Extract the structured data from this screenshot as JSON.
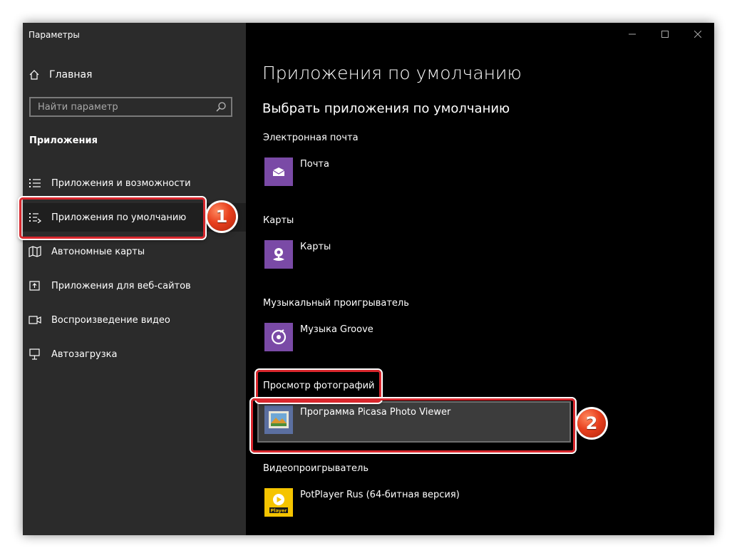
{
  "window": {
    "title": "Параметры"
  },
  "sidebar": {
    "home_label": "Главная",
    "search_placeholder": "Найти параметр",
    "section_title": "Приложения",
    "items": [
      {
        "label": "Приложения и возможности",
        "icon": "list-icon"
      },
      {
        "label": "Приложения по умолчанию",
        "icon": "default-apps-icon",
        "selected": true
      },
      {
        "label": "Автономные карты",
        "icon": "map-icon"
      },
      {
        "label": "Приложения для веб-сайтов",
        "icon": "web-app-icon"
      },
      {
        "label": "Воспроизведение видео",
        "icon": "video-icon"
      },
      {
        "label": "Автозагрузка",
        "icon": "startup-icon"
      }
    ]
  },
  "main": {
    "title": "Приложения по умолчанию",
    "subtitle": "Выбрать приложения по умолчанию",
    "categories": [
      {
        "label": "Электронная почта",
        "app": "Почта",
        "icon": "mail-icon"
      },
      {
        "label": "Карты",
        "app": "Карты",
        "icon": "maps-icon"
      },
      {
        "label": "Музыкальный проигрыватель",
        "app": "Музыка Groove",
        "icon": "groove-icon"
      },
      {
        "label": "Просмотр фотографий",
        "app": "Программа Picasa Photo Viewer",
        "icon": "photo-viewer-icon"
      },
      {
        "label": "Видеопроигрыватель",
        "app": "PotPlayer Rus (64-битная версия)",
        "icon": "potplayer-icon",
        "icon_text": "Player"
      }
    ]
  },
  "annotations": {
    "badge_1": "1",
    "badge_2": "2"
  },
  "colors": {
    "accent": "#7a4aa6",
    "annotation": "#d9272d",
    "sidebar_bg": "#2b2b2b",
    "main_bg": "#000000"
  }
}
